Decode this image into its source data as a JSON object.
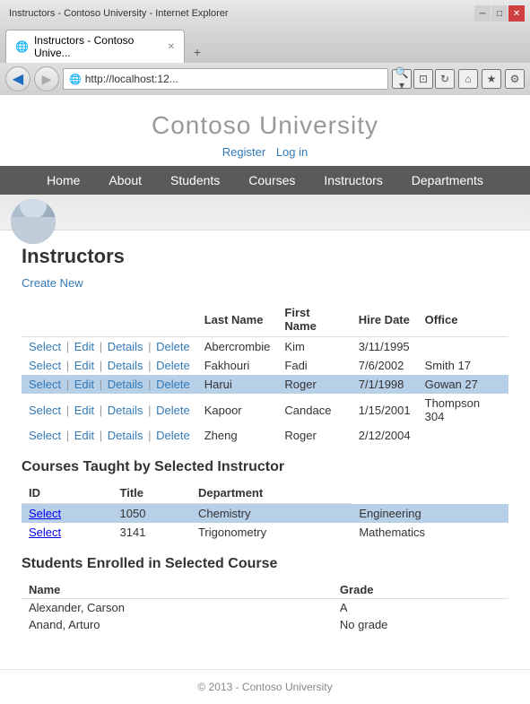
{
  "browser": {
    "back_icon": "◀",
    "forward_icon": "▶",
    "address": "http://localhost:12...",
    "search_icon": "🔍",
    "refresh_icon": "↻",
    "tab_label": "Instructors - Contoso Unive...",
    "tab_favicon": "🌐",
    "home_icon": "⌂",
    "star_icon": "★",
    "gear_icon": "⚙",
    "minimize": "─",
    "maximize": "□",
    "close": "✕",
    "pin_icon": "📌",
    "search2_icon": "▾",
    "compat_icon": "⊡",
    "tab_close": "✕"
  },
  "site": {
    "title": "Contoso University",
    "register_label": "Register",
    "login_label": "Log in"
  },
  "nav": {
    "items": [
      {
        "label": "Home"
      },
      {
        "label": "About"
      },
      {
        "label": "Students"
      },
      {
        "label": "Courses"
      },
      {
        "label": "Instructors"
      },
      {
        "label": "Departments"
      }
    ]
  },
  "page": {
    "heading": "Instructors",
    "create_new_label": "Create New"
  },
  "instructors_table": {
    "columns": [
      "",
      "Last Name",
      "First Name",
      "Hire Date",
      "Office"
    ],
    "rows": [
      {
        "actions": [
          "Select",
          "Edit",
          "Details",
          "Delete"
        ],
        "last_name": "Abercrombie",
        "first_name": "Kim",
        "hire_date": "3/11/1995",
        "office": "",
        "selected": false
      },
      {
        "actions": [
          "Select",
          "Edit",
          "Details",
          "Delete"
        ],
        "last_name": "Fakhouri",
        "first_name": "Fadi",
        "hire_date": "7/6/2002",
        "office": "Smith 17",
        "selected": false
      },
      {
        "actions": [
          "Select",
          "Edit",
          "Details",
          "Delete"
        ],
        "last_name": "Harui",
        "first_name": "Roger",
        "hire_date": "7/1/1998",
        "office": "Gowan 27",
        "selected": true
      },
      {
        "actions": [
          "Select",
          "Edit",
          "Details",
          "Delete"
        ],
        "last_name": "Kapoor",
        "first_name": "Candace",
        "hire_date": "1/15/2001",
        "office": "Thompson 304",
        "selected": false
      },
      {
        "actions": [
          "Select",
          "Edit",
          "Details",
          "Delete"
        ],
        "last_name": "Zheng",
        "first_name": "Roger",
        "hire_date": "2/12/2004",
        "office": "",
        "selected": false
      }
    ]
  },
  "courses_section": {
    "heading": "Courses Taught by Selected Instructor",
    "columns": [
      "ID",
      "Title",
      "Department"
    ],
    "rows": [
      {
        "id": "1050",
        "title": "Chemistry",
        "department": "Engineering",
        "selected": true
      },
      {
        "id": "3141",
        "title": "Trigonometry",
        "department": "Mathematics",
        "selected": false
      }
    ]
  },
  "students_section": {
    "heading": "Students Enrolled in Selected Course",
    "columns": [
      "Name",
      "Grade"
    ],
    "rows": [
      {
        "name": "Alexander, Carson",
        "grade": "A"
      },
      {
        "name": "Anand, Arturo",
        "grade": "No grade"
      }
    ]
  },
  "footer": {
    "text": "© 2013 - Contoso University"
  }
}
